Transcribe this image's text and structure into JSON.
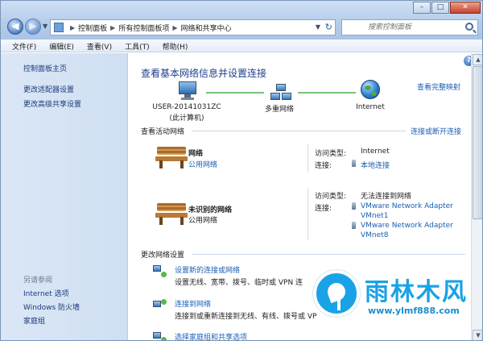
{
  "address": {
    "crumbs": [
      "控制面板",
      "所有控制面板项",
      "网络和共享中心"
    ],
    "search_placeholder": "搜索控制面板"
  },
  "window_buttons": {
    "minimize": "–",
    "maximize": "□",
    "close": "✕"
  },
  "menu": [
    "文件(F)",
    "编辑(E)",
    "查看(V)",
    "工具(T)",
    "帮助(H)"
  ],
  "sidebar": {
    "home": "控制面板主页",
    "links": [
      "更改适配器设置",
      "更改高级共享设置"
    ],
    "see_also_heading": "另请参阅",
    "see_also": [
      "Internet 选项",
      "Windows 防火墙",
      "家庭组"
    ]
  },
  "main": {
    "title": "查看基本网络信息并设置连接",
    "full_map": "查看完整映射",
    "map": {
      "computer_name": "USER-20141031ZC",
      "computer_sub": "(此计算机)",
      "middle": "多重网络",
      "internet": "Internet"
    },
    "active_heading": "查看活动网络",
    "connect_disconnect": "连接或断开连接",
    "networks": [
      {
        "name": "网络",
        "type": "公用网络",
        "access_label": "访问类型:",
        "access_value": "Internet",
        "conn_label": "连接:",
        "conn_values": [
          "本地连接"
        ]
      },
      {
        "name": "未识别的网络",
        "type": "公用网络",
        "access_label": "访问类型:",
        "access_value": "无法连接到网络",
        "conn_label": "连接:",
        "conn_values": [
          "VMware Network Adapter",
          "VMnet1",
          "VMware Network Adapter",
          "VMnet8"
        ]
      }
    ],
    "change_heading": "更改网络设置",
    "tasks": [
      {
        "link": "设置新的连接或网络",
        "desc": "设置无线、宽带、拨号、临时或 VPN 连"
      },
      {
        "link": "连接到网络",
        "desc": "连接到或重新连接到无线、有线、拨号或 VP"
      },
      {
        "link": "选择家庭组和共享选项",
        "desc": ""
      }
    ]
  },
  "watermark": {
    "title": "雨林木风",
    "url": "www.ylmf888.com"
  },
  "icons": {
    "back": "back-arrow-icon",
    "forward": "forward-arrow-icon",
    "refresh": "refresh-icon",
    "search": "search-icon",
    "help": "help-icon"
  },
  "colors": {
    "link": "#1a5fb4",
    "title": "#1e3f8a",
    "sidebar_bg": "#d4e3f4",
    "watermark": "#1aa2e6"
  }
}
